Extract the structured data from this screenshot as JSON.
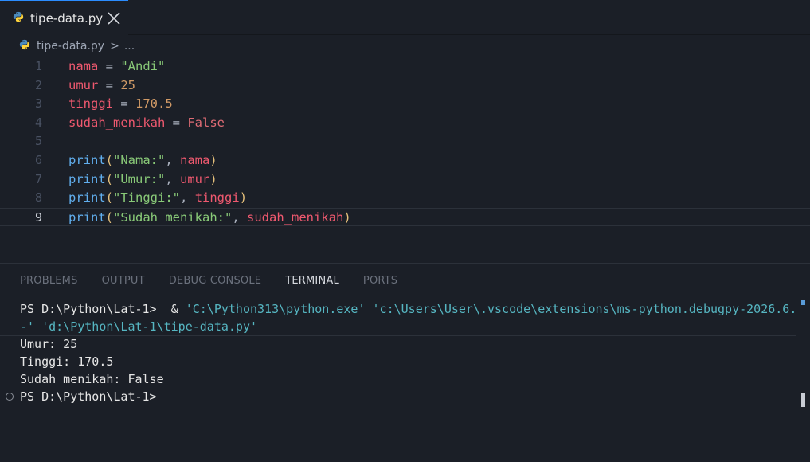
{
  "tab": {
    "filename": "tipe-data.py",
    "icon": "python-icon",
    "close_icon": "close-icon"
  },
  "breadcrumb": {
    "file": "tipe-data.py",
    "separator": ">",
    "more": "..."
  },
  "editor": {
    "active_line": 9,
    "lines": [
      {
        "n": "1",
        "tokens": [
          [
            "var",
            "nama"
          ],
          [
            "op",
            " = "
          ],
          [
            "str",
            "\"Andi\""
          ]
        ]
      },
      {
        "n": "2",
        "tokens": [
          [
            "var",
            "umur"
          ],
          [
            "op",
            " = "
          ],
          [
            "num",
            "25"
          ]
        ]
      },
      {
        "n": "3",
        "tokens": [
          [
            "var",
            "tinggi"
          ],
          [
            "op",
            " = "
          ],
          [
            "num",
            "170.5"
          ]
        ]
      },
      {
        "n": "4",
        "tokens": [
          [
            "var",
            "sudah_menikah"
          ],
          [
            "op",
            " = "
          ],
          [
            "bool",
            "False"
          ]
        ]
      },
      {
        "n": "5",
        "tokens": []
      },
      {
        "n": "6",
        "tokens": [
          [
            "fn",
            "print"
          ],
          [
            "paren",
            "("
          ],
          [
            "str",
            "\"Nama:\""
          ],
          [
            "op",
            ", "
          ],
          [
            "var",
            "nama"
          ],
          [
            "paren",
            ")"
          ]
        ]
      },
      {
        "n": "7",
        "tokens": [
          [
            "fn",
            "print"
          ],
          [
            "paren",
            "("
          ],
          [
            "str",
            "\"Umur:\""
          ],
          [
            "op",
            ", "
          ],
          [
            "var",
            "umur"
          ],
          [
            "paren",
            ")"
          ]
        ]
      },
      {
        "n": "8",
        "tokens": [
          [
            "fn",
            "print"
          ],
          [
            "paren",
            "("
          ],
          [
            "str",
            "\"Tinggi:\""
          ],
          [
            "op",
            ", "
          ],
          [
            "var",
            "tinggi"
          ],
          [
            "paren",
            ")"
          ]
        ]
      },
      {
        "n": "9",
        "tokens": [
          [
            "fn",
            "print"
          ],
          [
            "paren",
            "("
          ],
          [
            "str",
            "\"Sudah menikah:\""
          ],
          [
            "op",
            ", "
          ],
          [
            "var",
            "sudah_menikah"
          ],
          [
            "paren",
            ")"
          ]
        ]
      }
    ]
  },
  "panel": {
    "tabs": [
      "PROBLEMS",
      "OUTPUT",
      "DEBUG CONSOLE",
      "TERMINAL",
      "PORTS"
    ],
    "active_tab": "TERMINAL"
  },
  "terminal": {
    "cmd_prompt": "PS D:\\Python\\Lat-1>  & ",
    "cmd_exe": "'C:\\Python313\\python.exe'",
    "cmd_space": " ",
    "cmd_arg1_a": "'c:\\Users\\User\\.vscode\\extensions\\ms-python.debugpy-2026.6.",
    "cmd_arg1_b": "-'",
    "cmd_space2": " ",
    "cmd_arg2": "'d:\\Python\\Lat-1\\tipe-data.py'",
    "output": [
      "Umur: 25",
      "Tinggi: 170.5",
      "Sudah menikah: False"
    ],
    "prompt": "PS D:\\Python\\Lat-1>"
  },
  "colors": {
    "accent": "#2b8cff",
    "background": "#1b1f27"
  }
}
